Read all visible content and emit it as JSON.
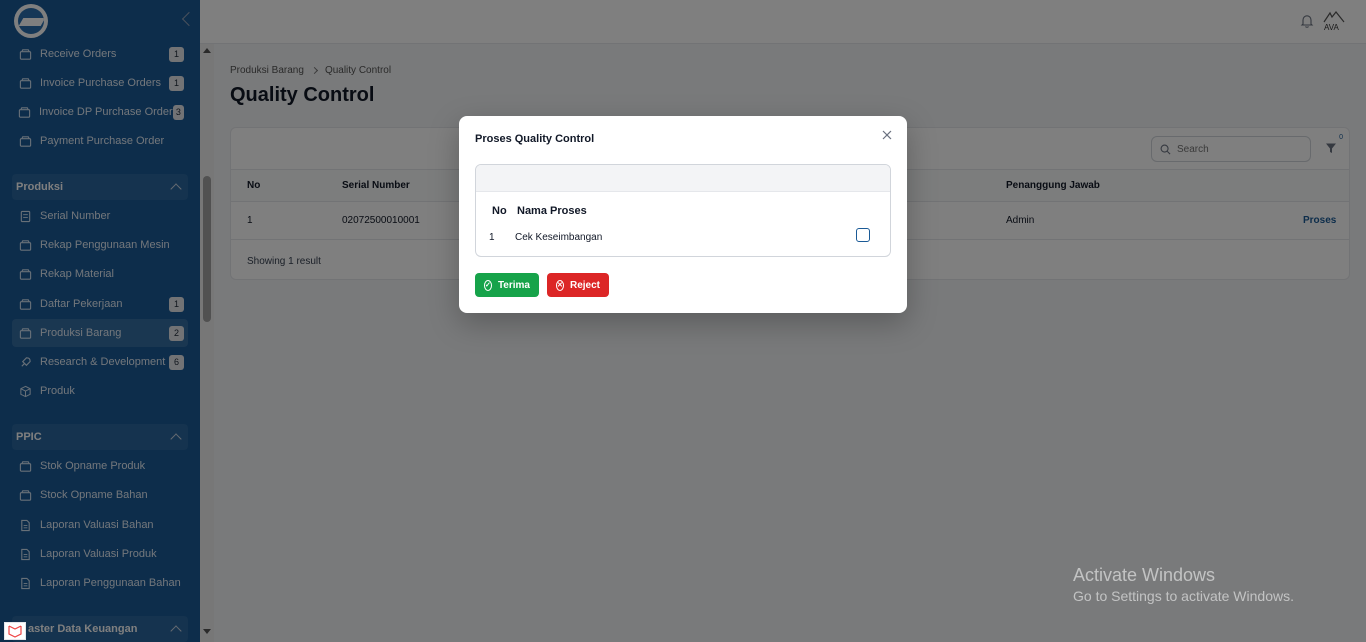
{
  "sidebar": {
    "items_top": [
      {
        "label": "Receive Orders",
        "badge": "1"
      },
      {
        "label": "Invoice Purchase Orders",
        "badge": "1"
      },
      {
        "label": "Invoice DP Purchase Order",
        "badge": "3"
      },
      {
        "label": "Payment Purchase Order",
        "badge": ""
      }
    ],
    "section_produksi": "Produksi",
    "items_produksi": [
      {
        "label": "Serial Number",
        "badge": ""
      },
      {
        "label": "Rekap Penggunaan Mesin",
        "badge": ""
      },
      {
        "label": "Rekap Material",
        "badge": ""
      },
      {
        "label": "Daftar Pekerjaan",
        "badge": "1"
      },
      {
        "label": "Produksi Barang",
        "badge": "2"
      },
      {
        "label": "Research & Development",
        "badge": "6"
      },
      {
        "label": "Produk",
        "badge": ""
      }
    ],
    "section_ppic": "PPIC",
    "items_ppic": [
      {
        "label": "Stok Opname Produk"
      },
      {
        "label": "Stock Opname Bahan"
      },
      {
        "label": "Laporan Valuasi Bahan"
      },
      {
        "label": "Laporan Valuasi Produk"
      },
      {
        "label": "Laporan Penggunaan Bahan"
      }
    ],
    "section_keuangan": "aster Data Keuangan"
  },
  "topbar": {
    "avatar_text": "AVA"
  },
  "main": {
    "breadcrumb": [
      "Produksi Barang",
      "Quality Control"
    ],
    "title": "Quality Control",
    "search_placeholder": "Search",
    "filter_count": "0",
    "columns": {
      "no": "No",
      "serial": "Serial Number",
      "pj": "Penanggung Jawab"
    },
    "row": {
      "no": "1",
      "serial": "02072500010001",
      "pj": "Admin",
      "action": "Proses"
    },
    "showing": "Showing 1 result"
  },
  "modal": {
    "title": "Proses Quality Control",
    "col_no": "No",
    "col_name": "Nama Proses",
    "row_no": "1",
    "row_name": "Cek Keseimbangan",
    "btn_accept": "Terima",
    "btn_reject": "Reject"
  },
  "watermark": {
    "line1": "Activate Windows",
    "line2": "Go to Settings to activate Windows."
  },
  "colors": {
    "sidebar": "#1a5a96",
    "accept": "#16a34a",
    "reject": "#dc2626"
  }
}
